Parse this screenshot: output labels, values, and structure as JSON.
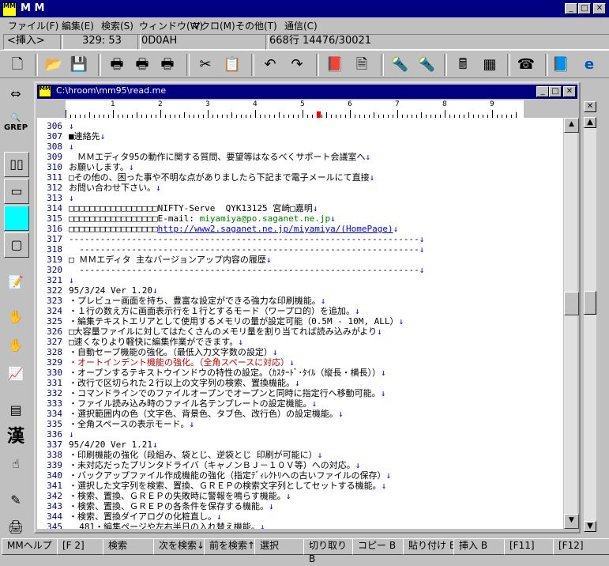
{
  "app": {
    "title": "M M"
  },
  "menu": [
    "ファイル(F)",
    "編集(E)",
    "検索(S)",
    "ウィンドウ(W)",
    "マクロ(M)",
    "その他(T)",
    "通信(C)"
  ],
  "status": {
    "mode": "<挿入>",
    "position": "329: 53",
    "code": "0D0AH",
    "lines": "668行 14476/30021"
  },
  "tools": {
    "grep": "GREP",
    "kanji": "漢"
  },
  "child": {
    "title": "C:\\hroom\\mm95\\read.me"
  },
  "ruler": [
    "1",
    "2",
    "3",
    "4",
    "5",
    "6",
    "7",
    "8",
    "9"
  ],
  "lines": [
    {
      "n": "306",
      "t": "",
      "e": "↓"
    },
    {
      "n": "307",
      "t": "■連絡先",
      "e": "↓"
    },
    {
      "n": "308",
      "t": "",
      "e": "↓"
    },
    {
      "n": "309",
      "t": "　ＭＭエディタ95の動作に関する質問、要望等はなるべくサポート会議室へ",
      "e": "↓"
    },
    {
      "n": "310",
      "t": "お願いします。",
      "e": "↓"
    },
    {
      "n": "311",
      "t": "□その他の、困った事や不明な点がありましたら下記まで電子メールにて直接",
      "e": "↓"
    },
    {
      "n": "312",
      "t": "お問い合わせ下さい。",
      "e": "↓"
    },
    {
      "n": "313",
      "t": "",
      "e": "↓"
    },
    {
      "n": "314",
      "t": "□□□□□□□□□□□□□□□□□NIFTY-Serve  QYK13125 宮崎□嘉明",
      "e": "↓"
    },
    {
      "n": "315",
      "t": "□□□□□□□□□□□□□□□□□E-mail: ",
      "g": "miyamiya@po.saganet.ne.jp",
      "e": "↓"
    },
    {
      "n": "316",
      "t": "□□□□□□□□□□□□□□□□□",
      "l": "http://www2.saganet.ne.jp/miyamiya/(HomePage)",
      "e": "↓"
    },
    {
      "n": "317",
      "t": "-------------------------------------------------------------------",
      "e": "↓"
    },
    {
      "n": "318",
      "t": "  -----------------------------------------------------------------",
      "e": "↓"
    },
    {
      "n": "319",
      "t": "□ ＭＭエディタ 主なバージョンアップ内容の履歴",
      "e": "↓"
    },
    {
      "n": "320",
      "t": "  -----------------------------------------------------------------",
      "e": "↓"
    },
    {
      "n": "321",
      "t": "",
      "e": "↓"
    },
    {
      "n": "322",
      "t": "95/3/24 Ver 1.20",
      "e": "↓"
    },
    {
      "n": "323",
      "t": "・プレビュー画面を持ち、豊富な設定ができる強力な印刷機能。",
      "e": "↓"
    },
    {
      "n": "324",
      "t": "・１行の数え方に画面表示行を１行とするモード（ワープロ的）を追加。",
      "e": "↓"
    },
    {
      "n": "325",
      "t": "・編集テキストエリアとして使用するメモリの量が設定可能（0.5M - 10M, ALL）",
      "e": "↓"
    },
    {
      "n": "326",
      "t": "□大容量ファイルに対してはたくさんのメモリ量を割り当てれば読み込みがより",
      "e": "↓"
    },
    {
      "n": "327",
      "t": "□速くなりより軽快に編集作業ができます。",
      "e": "↓"
    },
    {
      "n": "328",
      "t": "・自動セーブ機能の強化。（最低入力文字数の設定）",
      "e": "↓"
    },
    {
      "n": "329",
      "t": "・オートインデント機能の強化。（全角スペースに対応）",
      "e": "↓",
      "red": true
    },
    {
      "n": "330",
      "t": "・オープンするテキストウインドウの特性の設定。（ｶｽﾀｰﾄﾞ･ﾀｲﾙ（縦長・横長））",
      "e": "↓"
    },
    {
      "n": "331",
      "t": "・改行で区切られた２行以上の文字列の検索、置換機能。",
      "e": "↓"
    },
    {
      "n": "332",
      "t": "・コマンドラインでのファイルオープンでオープンと同時に指定行へ移動可能。",
      "e": "↓"
    },
    {
      "n": "333",
      "t": "・ファイル読み込み時のファイル名テンプレートの設定機能。",
      "e": "↓"
    },
    {
      "n": "334",
      "t": "・選択範囲内の色（文字色、背景色、タブ色、改行色）の設定機能。",
      "e": "↓"
    },
    {
      "n": "335",
      "t": "・全角スペースの表示モード。",
      "e": "↓"
    },
    {
      "n": "336",
      "t": "",
      "e": "↓"
    },
    {
      "n": "337",
      "t": "95/4/20 Ver 1.21",
      "e": "↓"
    },
    {
      "n": "338",
      "t": "・印刷機能の強化（段組み、袋とじ、逆袋とじ 印刷が可能に）",
      "e": "↓"
    },
    {
      "n": "339",
      "t": "・未対応だったプリンタドライバ（キャノンＢＪ－１０Ｖ等）への対応。",
      "e": "↓"
    },
    {
      "n": "340",
      "t": "・バックアップファイル作成機能の強化（指定ﾃﾞｨﾚｸﾄﾘへの古いファイルの保存）",
      "e": "↓"
    },
    {
      "n": "341",
      "t": "・選択した文字列を検索、置換、ＧＲＥＰの検索文字列としてセットする機能。",
      "e": "↓"
    },
    {
      "n": "342",
      "t": "・検索、置換、ＧＲＥＰの失敗時に警報を鳴らす機能。",
      "e": "↓"
    },
    {
      "n": "343",
      "t": "・検索、置換、ＧＲＥＰの各条件を保存する機能。",
      "e": "↓"
    },
    {
      "n": "344",
      "t": "・検索、置換ダイアログの化粧直し。",
      "e": "↓"
    },
    {
      "n": "345",
      "t": "  481・編集ページや左右半日の入れ替え機能。",
      "e": "↓"
    }
  ],
  "funcbar": [
    "MMヘルプ",
    "[F 2]",
    "検索",
    "次を検索↓",
    "前を検索↑",
    "選択",
    "切り取り B",
    "コピー B",
    "貼り付け B",
    "挿入 B",
    "[F11]",
    "[F12]"
  ]
}
